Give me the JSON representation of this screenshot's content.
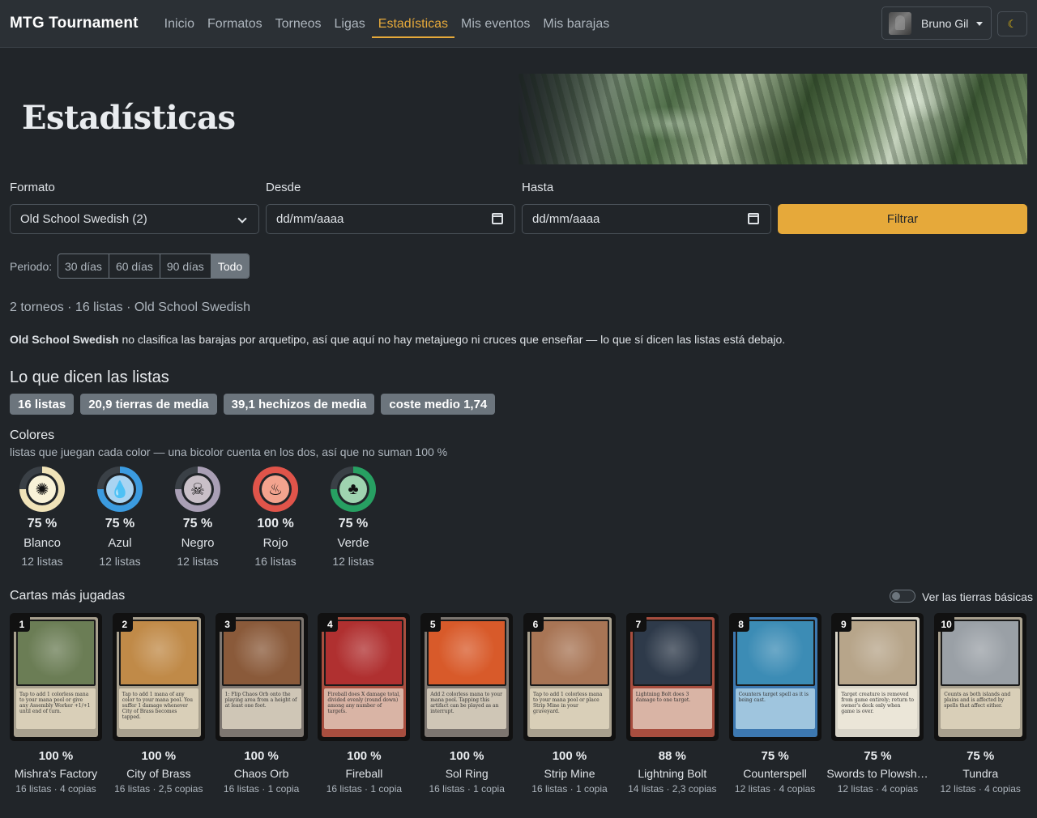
{
  "nav": {
    "brand": "MTG Tournament",
    "links": [
      "Inicio",
      "Formatos",
      "Torneos",
      "Ligas",
      "Estadísticas",
      "Mis eventos",
      "Mis barajas"
    ],
    "active_index": 4,
    "user_name": "Bruno Gil",
    "theme_icon": "moon-icon"
  },
  "hero": {
    "title": "Estadísticas"
  },
  "filters": {
    "format_label": "Formato",
    "format_value": "Old School Swedish (2)",
    "from_label": "Desde",
    "from_placeholder": "dd/mm/aaaa",
    "to_label": "Hasta",
    "to_placeholder": "dd/mm/aaaa",
    "submit": "Filtrar"
  },
  "period": {
    "label": "Periodo:",
    "options": [
      "30 días",
      "60 días",
      "90 días",
      "Todo"
    ],
    "active_index": 3
  },
  "summary": "2 torneos · 16 listas · Old School Swedish",
  "note": {
    "format_name": "Old School Swedish",
    "text": " no clasifica las barajas por arquetipo, así que aquí no hay metajuego ni cruces que enseñar — lo que sí dicen las listas está debajo."
  },
  "lists_section": {
    "title": "Lo que dicen las listas",
    "pills": [
      "16 listas",
      "20,9 tierras de media",
      "39,1 hechizos de media",
      "coste medio 1,74"
    ]
  },
  "colors": {
    "title": "Colores",
    "subtitle": "listas que juegan cada color — una bicolor cuenta en los dos, así que no suman 100 %",
    "items": [
      {
        "pct": "75 %",
        "fraction": 0.75,
        "name": "Blanco",
        "count": "12 listas",
        "ring": "#f0e3b8",
        "fill": "#f8f2d8",
        "icon": "sun-icon"
      },
      {
        "pct": "75 %",
        "fraction": 0.75,
        "name": "Azul",
        "count": "12 listas",
        "ring": "#3b9be0",
        "fill": "#a9d4f2",
        "icon": "water-drop-icon"
      },
      {
        "pct": "75 %",
        "fraction": 0.75,
        "name": "Negro",
        "count": "12 listas",
        "ring": "#a99fb5",
        "fill": "#c9c0c8",
        "icon": "skull-icon"
      },
      {
        "pct": "100 %",
        "fraction": 1.0,
        "name": "Rojo",
        "count": "16 listas",
        "ring": "#e0544a",
        "fill": "#f3a38e",
        "icon": "fire-icon"
      },
      {
        "pct": "75 %",
        "fraction": 0.75,
        "name": "Verde",
        "count": "12 listas",
        "ring": "#27a062",
        "fill": "#9fd3b0",
        "icon": "tree-icon"
      }
    ]
  },
  "cards": {
    "title": "Cartas más jugadas",
    "toggle_label": "Ver las tierras básicas",
    "items": [
      {
        "rank": "1",
        "pct": "100 %",
        "name": "Mishra's Factory",
        "sub": "16 listas · 4 copias",
        "art": "#6b7d55",
        "frame": "#a8a08e",
        "text_bg": "#d9cfb8",
        "text": "Tap to add 1 colorless mana to your mana pool or give any Assembly Worker +1/+1 until end of turn."
      },
      {
        "rank": "2",
        "pct": "100 %",
        "name": "City of Brass",
        "sub": "16 listas · 2,5 copias",
        "art": "#c08a48",
        "frame": "#a8a08e",
        "text_bg": "#d9cfb8",
        "text": "Tap to add 1 mana of any color to your mana pool. You suffer 1 damage whenever City of Brass becomes tapped."
      },
      {
        "rank": "3",
        "pct": "100 %",
        "name": "Chaos Orb",
        "sub": "16 listas · 1 copia",
        "art": "#8a5a3a",
        "frame": "#7d7670",
        "text_bg": "#cfc6b6",
        "text": "1: Flip Chaos Orb onto the playing area from a height of at least one foot."
      },
      {
        "rank": "4",
        "pct": "100 %",
        "name": "Fireball",
        "sub": "16 listas · 1 copia",
        "art": "#b03030",
        "frame": "#a84e3f",
        "text_bg": "#d9b4a5",
        "text": "Fireball does X damage total, divided evenly (round down) among any number of targets."
      },
      {
        "rank": "5",
        "pct": "100 %",
        "name": "Sol Ring",
        "sub": "16 listas · 1 copia",
        "art": "#d85a2a",
        "frame": "#7d7670",
        "text_bg": "#cfc6b6",
        "text": "Add 2 colorless mana to your mana pool. Tapping this artifact can be played as an interrupt."
      },
      {
        "rank": "6",
        "pct": "100 %",
        "name": "Strip Mine",
        "sub": "16 listas · 1 copia",
        "art": "#a87555",
        "frame": "#a8a08e",
        "text_bg": "#d9cfb8",
        "text": "Tap to add 1 colorless mana to your mana pool or place Strip Mine in your graveyard."
      },
      {
        "rank": "7",
        "pct": "88 %",
        "name": "Lightning Bolt",
        "sub": "14 listas · 2,3 copias",
        "art": "#2e3a4a",
        "frame": "#a84e3f",
        "text_bg": "#d9b4a5",
        "text": "Lightning Bolt does 3 damage to one target."
      },
      {
        "rank": "8",
        "pct": "75 %",
        "name": "Counterspell",
        "sub": "12 listas · 4 copias",
        "art": "#3c8cb5",
        "frame": "#3d78b0",
        "text_bg": "#9fc5de",
        "text": "Counters target spell as it is being cast."
      },
      {
        "rank": "9",
        "pct": "75 %",
        "name": "Swords to Plowshares",
        "sub": "12 listas · 4 copias",
        "art": "#b7a58a",
        "frame": "#d8d4c8",
        "text_bg": "#ebe6d8",
        "text": "Target creature is removed from game entirely; return to owner's deck only when game is over."
      },
      {
        "rank": "10",
        "pct": "75 %",
        "name": "Tundra",
        "sub": "12 listas · 4 copias",
        "art": "#9aa0a6",
        "frame": "#a8a08e",
        "text_bg": "#d9cfb8",
        "text": "Counts as both islands and plains and is affected by spells that affect either."
      }
    ]
  }
}
